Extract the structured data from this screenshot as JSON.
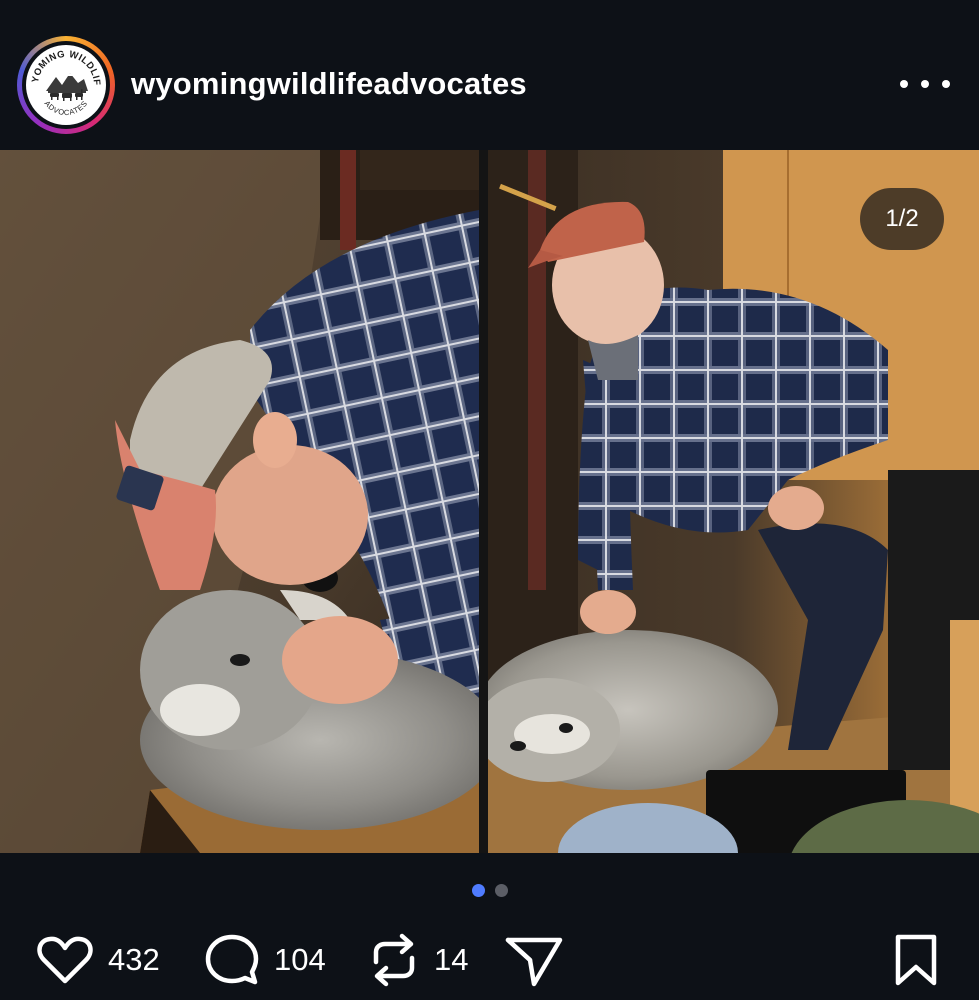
{
  "post": {
    "username": "wyomingwildlifeadvocates",
    "avatar_text_top": "WYOMING WILDLIFE",
    "avatar_text_bottom": "ADVOCATES",
    "image_counter": "1/2",
    "carousel": {
      "total": 2,
      "active_index": 0
    }
  },
  "actions": {
    "likes": "432",
    "comments": "104",
    "reposts": "14"
  },
  "colors": {
    "background": "#0d1117",
    "active_dot": "#4f7cff",
    "inactive_dot": "#5b5e66"
  },
  "icons": {
    "like": "heart-icon",
    "comment": "comment-bubble-icon",
    "repost": "repost-icon",
    "share": "send-icon",
    "save": "bookmark-icon",
    "menu": "more-options-icon"
  }
}
